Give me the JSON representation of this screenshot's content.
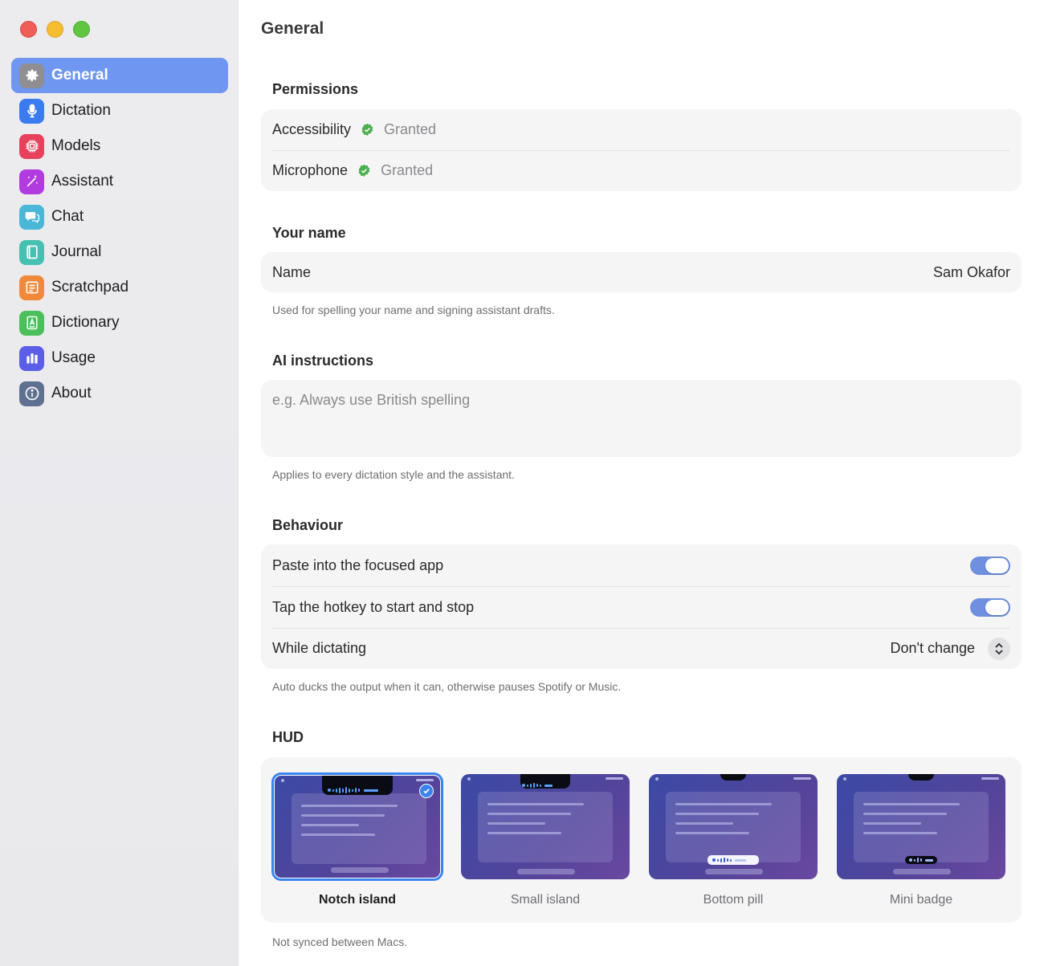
{
  "sidebar": {
    "items": [
      {
        "label": "General",
        "icon": "gear-icon",
        "color": "#8e8e93",
        "active": true
      },
      {
        "label": "Dictation",
        "icon": "microphone-icon",
        "color": "#3a7bf0",
        "active": false
      },
      {
        "label": "Models",
        "icon": "cpu-chip-icon",
        "color": "#e8415c",
        "active": false
      },
      {
        "label": "Assistant",
        "icon": "magic-wand-icon",
        "color": "#b23be0",
        "active": false
      },
      {
        "label": "Chat",
        "icon": "chat-bubbles-icon",
        "color": "#4ab6d8",
        "active": false
      },
      {
        "label": "Journal",
        "icon": "book-icon",
        "color": "#46c0b0",
        "active": false
      },
      {
        "label": "Scratchpad",
        "icon": "notepad-icon",
        "color": "#f08a3a",
        "active": false
      },
      {
        "label": "Dictionary",
        "icon": "dictionary-icon",
        "color": "#4bbf5a",
        "active": false
      },
      {
        "label": "Usage",
        "icon": "bar-chart-icon",
        "color": "#5b5ee6",
        "active": false
      },
      {
        "label": "About",
        "icon": "info-icon",
        "color": "#5f7190",
        "active": false
      }
    ]
  },
  "main": {
    "title": "General",
    "permissions": {
      "heading": "Permissions",
      "rows": [
        {
          "label": "Accessibility",
          "status": "Granted"
        },
        {
          "label": "Microphone",
          "status": "Granted"
        }
      ]
    },
    "name": {
      "heading": "Your name",
      "label": "Name",
      "value": "Sam Okafor",
      "note": "Used for spelling your name and signing assistant drafts."
    },
    "ai": {
      "heading": "AI instructions",
      "placeholder": "e.g. Always use British spelling",
      "note": "Applies to every dictation style and the assistant."
    },
    "behaviour": {
      "heading": "Behaviour",
      "paste_label": "Paste into the focused app",
      "paste_on": true,
      "tap_label": "Tap the hotkey to start and stop",
      "tap_on": true,
      "while_label": "While dictating",
      "while_value": "Don't change",
      "note": "Auto ducks the output when it can, otherwise pauses Spotify or Music."
    },
    "hud": {
      "heading": "HUD",
      "options": [
        {
          "label": "Notch island",
          "selected": true
        },
        {
          "label": "Small island",
          "selected": false
        },
        {
          "label": "Bottom pill",
          "selected": false
        },
        {
          "label": "Mini badge",
          "selected": false
        }
      ],
      "note": "Not synced between Macs."
    }
  },
  "colors": {
    "accent": "#6f96f0",
    "granted": "#4caf50",
    "toggle_on": "#6f8fe0"
  }
}
